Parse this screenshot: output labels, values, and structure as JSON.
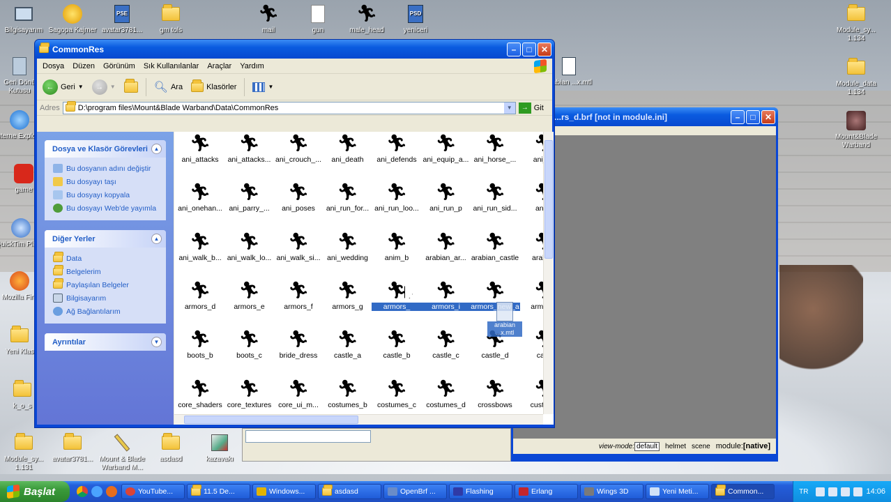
{
  "desktop": {
    "top_icons": [
      {
        "label": "Bilgisayarım",
        "icon": "computer-icon"
      },
      {
        "label": "Sagopa Kajmer Kal...",
        "icon": "media-icon"
      },
      {
        "label": "avatar3781...",
        "icon": "psd-icon"
      },
      {
        "label": "gm tols",
        "icon": "folder-icon"
      },
      {
        "label": "mail",
        "icon": "runner-icon"
      },
      {
        "label": "gun",
        "icon": "document-icon"
      },
      {
        "label": "male_head",
        "icon": "runner-icon"
      },
      {
        "label": "yeniceri",
        "icon": "psd-icon"
      },
      {
        "label": "Module_sy... 1.134",
        "icon": "folder-icon"
      }
    ],
    "left_icons": [
      {
        "label": "Geri Dönü Kutusu",
        "icon": "recycle-bin-icon"
      },
      {
        "label": "Interne Explorer",
        "icon": "ie-icon"
      },
      {
        "label": "game",
        "icon": "game-icon"
      },
      {
        "label": "QuickTim Player",
        "icon": "quicktime-icon"
      },
      {
        "label": "Mozilla Fire",
        "icon": "firefox-icon"
      },
      {
        "label": "Yeni Klas",
        "icon": "folder-icon"
      },
      {
        "label": "k_o_s",
        "icon": "folder-icon"
      }
    ],
    "right_icons": [
      {
        "label": "arabian ...x.mtl",
        "icon": "mtl-icon"
      },
      {
        "label": "Module_data 1.134",
        "icon": "folder-icon"
      },
      {
        "label": "Mount&Blade Warband",
        "icon": "warband-icon"
      }
    ],
    "bottom_icons": [
      {
        "label": "Module_sy... 1.131",
        "icon": "folder-icon"
      },
      {
        "label": "avatar3781...",
        "icon": "folder-icon"
      },
      {
        "label": "Mount & Blade Warband M...",
        "icon": "pen-icon"
      },
      {
        "label": "asdasd",
        "icon": "folder-icon"
      },
      {
        "label": "kazavakı",
        "icon": "tool-icon"
      }
    ]
  },
  "explorer": {
    "title": "CommonRes",
    "menu": [
      "Dosya",
      "Düzen",
      "Görünüm",
      "Sık Kullanılanlar",
      "Araçlar",
      "Yardım"
    ],
    "toolbar": {
      "back": "Geri",
      "search": "Ara",
      "folders": "Klasörler"
    },
    "address_label": "Adres",
    "address": "D:\\program files\\Mount&Blade Warband\\Data\\CommonRes",
    "go": "Git",
    "tasks_panel": {
      "title": "Dosya ve Klasör Görevleri",
      "items": [
        "Bu dosyanın adını değiştir",
        "Bu dosyayı taşı",
        "Bu dosyayı kopyala",
        "Bu dosyayı Web'de yayımla"
      ]
    },
    "places_panel": {
      "title": "Diğer Yerler",
      "items": [
        "Data",
        "Belgelerim",
        "Paylaşılan Belgeler",
        "Bilgisayarım",
        "Ağ Bağlantılarım"
      ]
    },
    "details_panel": {
      "title": "Ayrıntılar"
    },
    "files": [
      [
        "ani_attacks",
        "ani_attacks...",
        "ani_crouch_...",
        "ani_death",
        "ani_defends",
        "ani_equip_a...",
        "ani_horse_...",
        "ani_hu"
      ],
      [
        "ani_onehan...",
        "ani_parry_...",
        "ani_poses",
        "ani_run_for...",
        "ani_run_loo...",
        "ani_run_p",
        "ani_run_sid...",
        "ani_s"
      ],
      [
        "ani_walk_b...",
        "ani_walk_lo...",
        "ani_walk_si...",
        "ani_wedding",
        "anim_b",
        "arabian_ar...",
        "arabian_castle",
        "arabian"
      ],
      [
        "armors_d",
        "armors_e",
        "armors_f",
        "armors_g",
        "armors_",
        "armors_i",
        "armors_new_a",
        "armors_"
      ],
      [
        "boots_b",
        "boots_c",
        "bride_dress",
        "castle_a",
        "castle_b",
        "castle_c",
        "castle_d",
        "castl"
      ],
      [
        "core_shaders",
        "core_textures",
        "core_ui_m...",
        "costumes_b",
        "costumes_c",
        "costumes_d",
        "crossbows",
        "custom_"
      ]
    ],
    "drag_label": "arabian ...x.mtl"
  },
  "openbrf": {
    "title": "...rs_d.brf [not in module.ini]",
    "status": {
      "view_mode_label": "view-mode:",
      "view_mode": "default",
      "helmet": "helmet",
      "scene": "scene",
      "module_label": "module:",
      "module": "[native]"
    }
  },
  "taskbar": {
    "start": "Başlat",
    "tasks": [
      "YouTube...",
      "11.5 De...",
      "Windows...",
      "asdasd",
      "OpenBrf ...",
      "Flashing",
      "Erlang",
      "Wings 3D",
      "Yeni Meti...",
      "Common..."
    ],
    "lang": "TR",
    "clock": "14:06"
  }
}
